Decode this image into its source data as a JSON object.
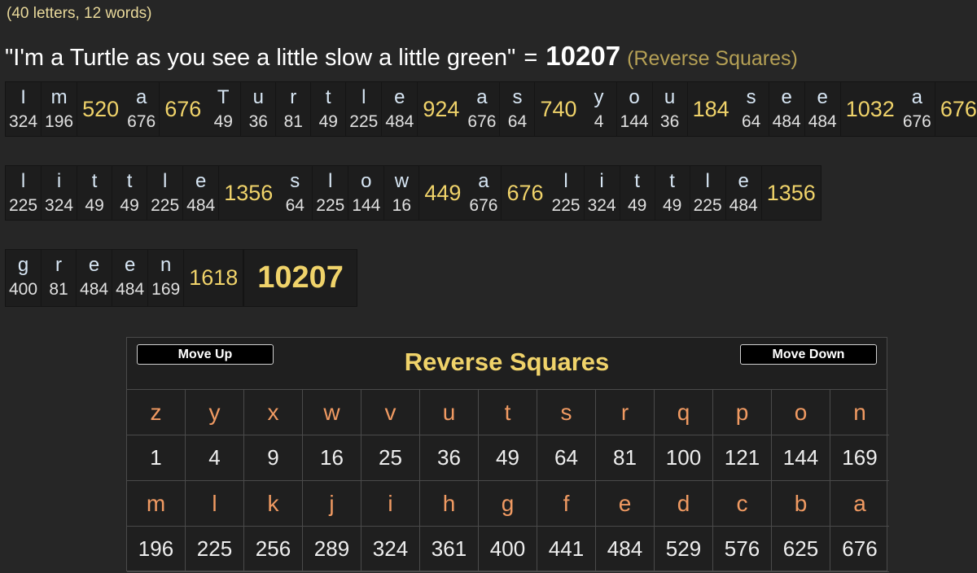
{
  "stats": "(40 letters, 12 words)",
  "phrase": {
    "text": "\"I'm a Turtle as you see a little slow a little green\"",
    "equals": "=",
    "total": "10207",
    "cipher": "(Reverse Squares)"
  },
  "rows": [
    {
      "words": [
        {
          "letters": [
            {
              "ch": "I",
              "v": "324"
            },
            {
              "ch": "m",
              "v": "196"
            }
          ],
          "total": "520"
        },
        {
          "letters": [
            {
              "ch": "a",
              "v": "676"
            }
          ],
          "total": "676"
        },
        {
          "letters": [
            {
              "ch": "T",
              "v": "49"
            },
            {
              "ch": "u",
              "v": "36"
            },
            {
              "ch": "r",
              "v": "81"
            },
            {
              "ch": "t",
              "v": "49"
            },
            {
              "ch": "l",
              "v": "225"
            },
            {
              "ch": "e",
              "v": "484"
            }
          ],
          "total": "924"
        },
        {
          "letters": [
            {
              "ch": "a",
              "v": "676"
            },
            {
              "ch": "s",
              "v": "64"
            }
          ],
          "total": "740"
        },
        {
          "letters": [
            {
              "ch": "y",
              "v": "4"
            },
            {
              "ch": "o",
              "v": "144"
            },
            {
              "ch": "u",
              "v": "36"
            }
          ],
          "total": "184"
        },
        {
          "letters": [
            {
              "ch": "s",
              "v": "64"
            },
            {
              "ch": "e",
              "v": "484"
            },
            {
              "ch": "e",
              "v": "484"
            }
          ],
          "total": "1032"
        },
        {
          "letters": [
            {
              "ch": "a",
              "v": "676"
            }
          ],
          "total": "676"
        }
      ]
    },
    {
      "words": [
        {
          "letters": [
            {
              "ch": "l",
              "v": "225"
            },
            {
              "ch": "i",
              "v": "324"
            },
            {
              "ch": "t",
              "v": "49"
            },
            {
              "ch": "t",
              "v": "49"
            },
            {
              "ch": "l",
              "v": "225"
            },
            {
              "ch": "e",
              "v": "484"
            }
          ],
          "total": "1356"
        },
        {
          "letters": [
            {
              "ch": "s",
              "v": "64"
            },
            {
              "ch": "l",
              "v": "225"
            },
            {
              "ch": "o",
              "v": "144"
            },
            {
              "ch": "w",
              "v": "16"
            }
          ],
          "total": "449"
        },
        {
          "letters": [
            {
              "ch": "a",
              "v": "676"
            }
          ],
          "total": "676"
        },
        {
          "letters": [
            {
              "ch": "l",
              "v": "225"
            },
            {
              "ch": "i",
              "v": "324"
            },
            {
              "ch": "t",
              "v": "49"
            },
            {
              "ch": "t",
              "v": "49"
            },
            {
              "ch": "l",
              "v": "225"
            },
            {
              "ch": "e",
              "v": "484"
            }
          ],
          "total": "1356"
        }
      ]
    },
    {
      "words": [
        {
          "letters": [
            {
              "ch": "g",
              "v": "400"
            },
            {
              "ch": "r",
              "v": "81"
            },
            {
              "ch": "e",
              "v": "484"
            },
            {
              "ch": "e",
              "v": "484"
            },
            {
              "ch": "n",
              "v": "169"
            }
          ],
          "total": "1618"
        }
      ],
      "grand_total": "10207"
    }
  ],
  "panel": {
    "move_up": "Move Up",
    "move_down": "Move Down",
    "title": "Reverse Squares",
    "table": [
      [
        "z",
        "y",
        "x",
        "w",
        "v",
        "u",
        "t",
        "s",
        "r",
        "q",
        "p",
        "o",
        "n"
      ],
      [
        "1",
        "4",
        "9",
        "16",
        "25",
        "36",
        "49",
        "64",
        "81",
        "100",
        "121",
        "144",
        "169"
      ],
      [
        "m",
        "l",
        "k",
        "j",
        "i",
        "h",
        "g",
        "f",
        "e",
        "d",
        "c",
        "b",
        "a"
      ],
      [
        "196",
        "225",
        "256",
        "289",
        "324",
        "361",
        "400",
        "441",
        "484",
        "529",
        "576",
        "625",
        "676"
      ]
    ]
  }
}
